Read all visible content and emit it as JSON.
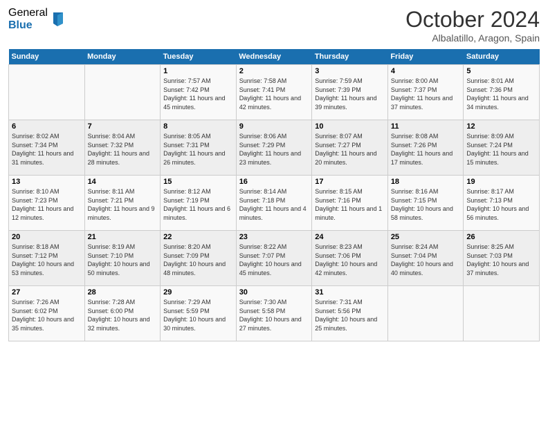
{
  "header": {
    "logo_general": "General",
    "logo_blue": "Blue",
    "month_title": "October 2024",
    "subtitle": "Albalatillo, Aragon, Spain"
  },
  "days_of_week": [
    "Sunday",
    "Monday",
    "Tuesday",
    "Wednesday",
    "Thursday",
    "Friday",
    "Saturday"
  ],
  "weeks": [
    [
      {
        "day": "",
        "details": ""
      },
      {
        "day": "",
        "details": ""
      },
      {
        "day": "1",
        "details": "Sunrise: 7:57 AM\nSunset: 7:42 PM\nDaylight: 11 hours and 45 minutes."
      },
      {
        "day": "2",
        "details": "Sunrise: 7:58 AM\nSunset: 7:41 PM\nDaylight: 11 hours and 42 minutes."
      },
      {
        "day": "3",
        "details": "Sunrise: 7:59 AM\nSunset: 7:39 PM\nDaylight: 11 hours and 39 minutes."
      },
      {
        "day": "4",
        "details": "Sunrise: 8:00 AM\nSunset: 7:37 PM\nDaylight: 11 hours and 37 minutes."
      },
      {
        "day": "5",
        "details": "Sunrise: 8:01 AM\nSunset: 7:36 PM\nDaylight: 11 hours and 34 minutes."
      }
    ],
    [
      {
        "day": "6",
        "details": "Sunrise: 8:02 AM\nSunset: 7:34 PM\nDaylight: 11 hours and 31 minutes."
      },
      {
        "day": "7",
        "details": "Sunrise: 8:04 AM\nSunset: 7:32 PM\nDaylight: 11 hours and 28 minutes."
      },
      {
        "day": "8",
        "details": "Sunrise: 8:05 AM\nSunset: 7:31 PM\nDaylight: 11 hours and 26 minutes."
      },
      {
        "day": "9",
        "details": "Sunrise: 8:06 AM\nSunset: 7:29 PM\nDaylight: 11 hours and 23 minutes."
      },
      {
        "day": "10",
        "details": "Sunrise: 8:07 AM\nSunset: 7:27 PM\nDaylight: 11 hours and 20 minutes."
      },
      {
        "day": "11",
        "details": "Sunrise: 8:08 AM\nSunset: 7:26 PM\nDaylight: 11 hours and 17 minutes."
      },
      {
        "day": "12",
        "details": "Sunrise: 8:09 AM\nSunset: 7:24 PM\nDaylight: 11 hours and 15 minutes."
      }
    ],
    [
      {
        "day": "13",
        "details": "Sunrise: 8:10 AM\nSunset: 7:23 PM\nDaylight: 11 hours and 12 minutes."
      },
      {
        "day": "14",
        "details": "Sunrise: 8:11 AM\nSunset: 7:21 PM\nDaylight: 11 hours and 9 minutes."
      },
      {
        "day": "15",
        "details": "Sunrise: 8:12 AM\nSunset: 7:19 PM\nDaylight: 11 hours and 6 minutes."
      },
      {
        "day": "16",
        "details": "Sunrise: 8:14 AM\nSunset: 7:18 PM\nDaylight: 11 hours and 4 minutes."
      },
      {
        "day": "17",
        "details": "Sunrise: 8:15 AM\nSunset: 7:16 PM\nDaylight: 11 hours and 1 minute."
      },
      {
        "day": "18",
        "details": "Sunrise: 8:16 AM\nSunset: 7:15 PM\nDaylight: 10 hours and 58 minutes."
      },
      {
        "day": "19",
        "details": "Sunrise: 8:17 AM\nSunset: 7:13 PM\nDaylight: 10 hours and 56 minutes."
      }
    ],
    [
      {
        "day": "20",
        "details": "Sunrise: 8:18 AM\nSunset: 7:12 PM\nDaylight: 10 hours and 53 minutes."
      },
      {
        "day": "21",
        "details": "Sunrise: 8:19 AM\nSunset: 7:10 PM\nDaylight: 10 hours and 50 minutes."
      },
      {
        "day": "22",
        "details": "Sunrise: 8:20 AM\nSunset: 7:09 PM\nDaylight: 10 hours and 48 minutes."
      },
      {
        "day": "23",
        "details": "Sunrise: 8:22 AM\nSunset: 7:07 PM\nDaylight: 10 hours and 45 minutes."
      },
      {
        "day": "24",
        "details": "Sunrise: 8:23 AM\nSunset: 7:06 PM\nDaylight: 10 hours and 42 minutes."
      },
      {
        "day": "25",
        "details": "Sunrise: 8:24 AM\nSunset: 7:04 PM\nDaylight: 10 hours and 40 minutes."
      },
      {
        "day": "26",
        "details": "Sunrise: 8:25 AM\nSunset: 7:03 PM\nDaylight: 10 hours and 37 minutes."
      }
    ],
    [
      {
        "day": "27",
        "details": "Sunrise: 7:26 AM\nSunset: 6:02 PM\nDaylight: 10 hours and 35 minutes."
      },
      {
        "day": "28",
        "details": "Sunrise: 7:28 AM\nSunset: 6:00 PM\nDaylight: 10 hours and 32 minutes."
      },
      {
        "day": "29",
        "details": "Sunrise: 7:29 AM\nSunset: 5:59 PM\nDaylight: 10 hours and 30 minutes."
      },
      {
        "day": "30",
        "details": "Sunrise: 7:30 AM\nSunset: 5:58 PM\nDaylight: 10 hours and 27 minutes."
      },
      {
        "day": "31",
        "details": "Sunrise: 7:31 AM\nSunset: 5:56 PM\nDaylight: 10 hours and 25 minutes."
      },
      {
        "day": "",
        "details": ""
      },
      {
        "day": "",
        "details": ""
      }
    ]
  ]
}
